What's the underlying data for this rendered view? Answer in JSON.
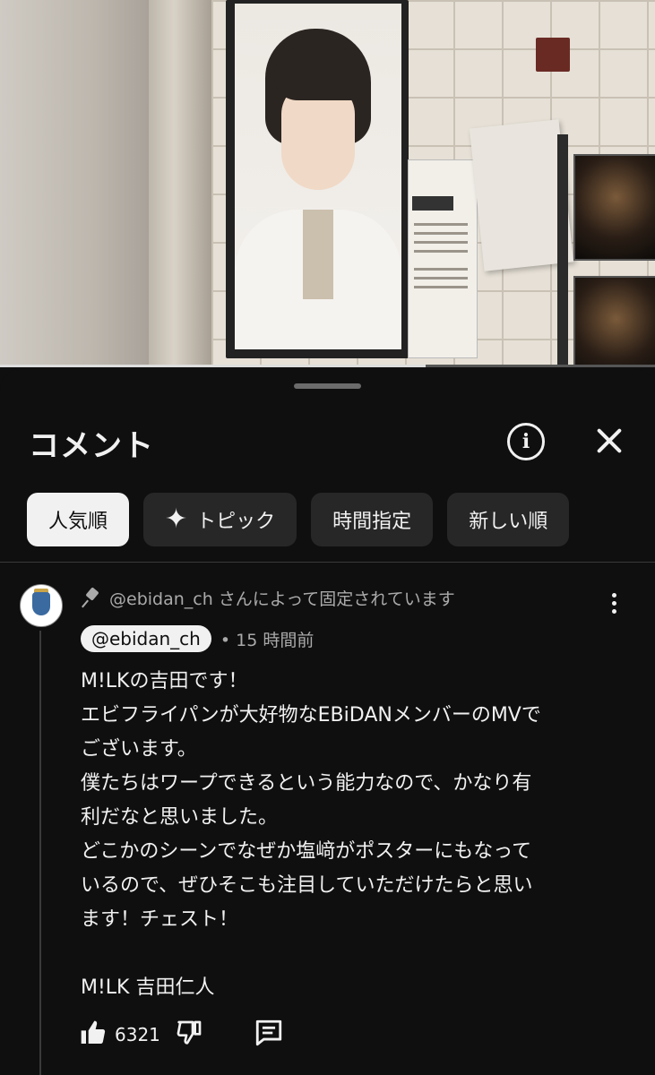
{
  "video": {
    "progress": 0.65
  },
  "sheet": {
    "title": "コメント",
    "chips": [
      {
        "label": "人気順",
        "active": true
      },
      {
        "label": "トピック",
        "active": false
      },
      {
        "label": "時間指定",
        "active": false
      },
      {
        "label": "新しい順",
        "active": false
      }
    ]
  },
  "comment": {
    "pinned_text": "@ebidan_ch さんによって固定されています",
    "author": "@ebidan_ch",
    "time": "• 15 時間前",
    "lines": [
      "M!LKの吉田です！",
      "エビフライパンが大好物なEBiDANメンバーのMVで",
      "ございます。",
      "僕たちはワープできるという能力なので、かなり有",
      "利だなと思いました。",
      "どこかのシーンでなぜか塩﨑がポスターにもなって",
      "いるので、ぜひそこも注目していただけたらと思い",
      "ます！チェスト！",
      "",
      "M!LK 吉田仁人"
    ],
    "likes": "6321"
  }
}
